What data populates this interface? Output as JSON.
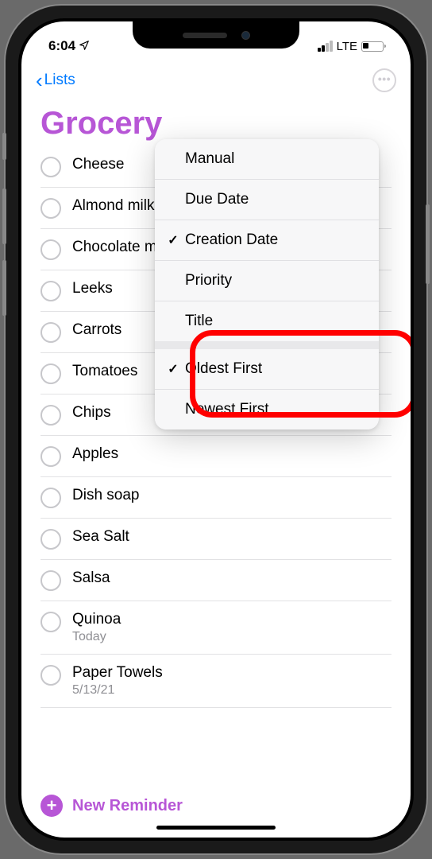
{
  "status": {
    "time": "6:04",
    "network": "LTE"
  },
  "nav": {
    "back_label": "Lists"
  },
  "list": {
    "title": "Grocery"
  },
  "reminders": [
    {
      "title": "Cheese",
      "sub": ""
    },
    {
      "title": "Almond milk",
      "sub": ""
    },
    {
      "title": "Chocolate milk",
      "sub": ""
    },
    {
      "title": "Leeks",
      "sub": ""
    },
    {
      "title": "Carrots",
      "sub": ""
    },
    {
      "title": "Tomatoes",
      "sub": ""
    },
    {
      "title": "Chips",
      "sub": ""
    },
    {
      "title": "Apples",
      "sub": ""
    },
    {
      "title": "Dish soap",
      "sub": ""
    },
    {
      "title": "Sea Salt",
      "sub": ""
    },
    {
      "title": "Salsa",
      "sub": ""
    },
    {
      "title": "Quinoa",
      "sub": "Today"
    },
    {
      "title": "Paper Towels",
      "sub": "5/13/21"
    }
  ],
  "sort_menu": {
    "group1": [
      {
        "label": "Manual",
        "checked": false
      },
      {
        "label": "Due Date",
        "checked": false
      },
      {
        "label": "Creation Date",
        "checked": true
      },
      {
        "label": "Priority",
        "checked": false
      },
      {
        "label": "Title",
        "checked": false
      }
    ],
    "group2": [
      {
        "label": "Oldest First",
        "checked": true
      },
      {
        "label": "Newest First",
        "checked": false
      }
    ]
  },
  "footer": {
    "new_reminder_label": "New Reminder"
  }
}
